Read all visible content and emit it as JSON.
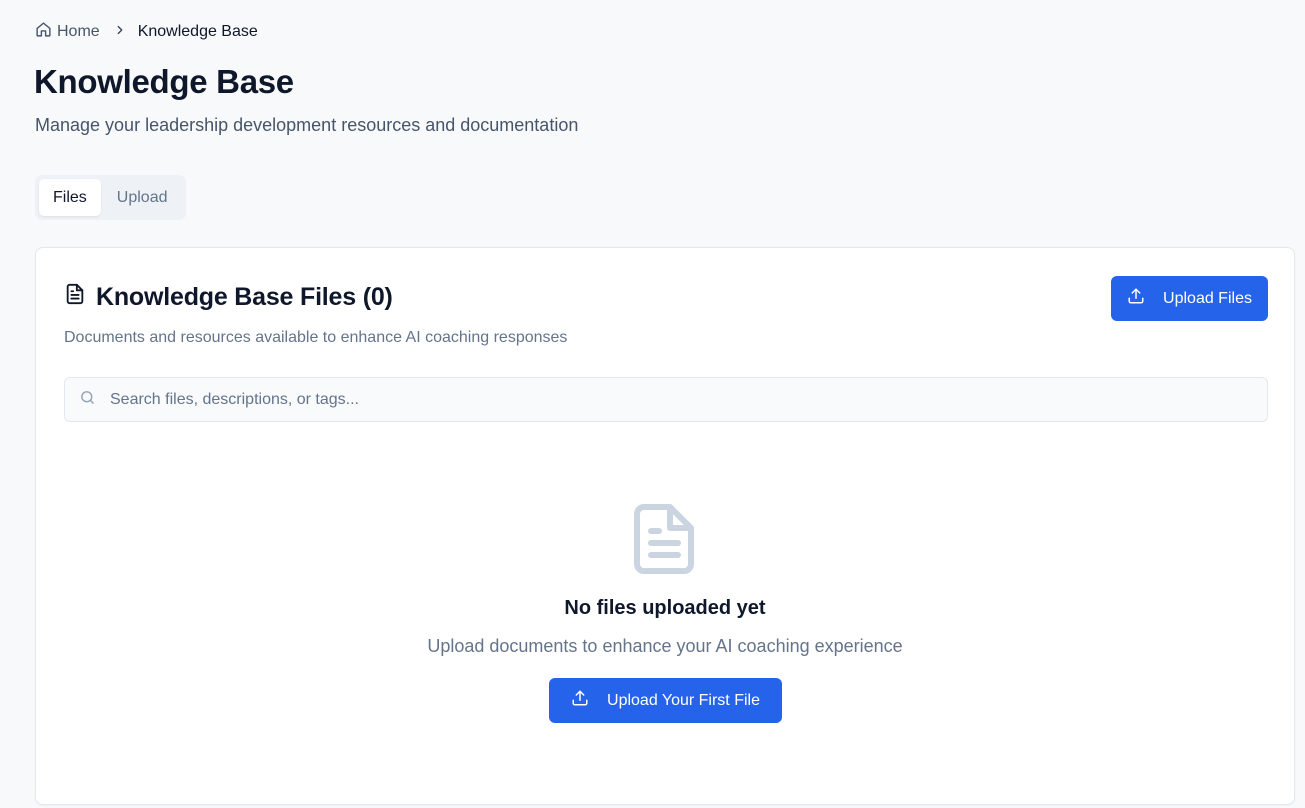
{
  "breadcrumb": {
    "home_label": "Home",
    "current_label": "Knowledge Base"
  },
  "header": {
    "title": "Knowledge Base",
    "subtitle": "Manage your leadership development resources and documentation"
  },
  "tabs": [
    {
      "label": "Files",
      "active": true
    },
    {
      "label": "Upload",
      "active": false
    }
  ],
  "files_card": {
    "title": "Knowledge Base Files (0)",
    "description": "Documents and resources available to enhance AI coaching responses",
    "upload_button_label": "Upload Files",
    "search": {
      "placeholder": "Search files, descriptions, or tags...",
      "value": ""
    },
    "empty_state": {
      "title": "No files uploaded yet",
      "description": "Upload documents to enhance your AI coaching experience",
      "button_label": "Upload Your First File"
    }
  },
  "icons": {
    "home": "home-icon",
    "separator": "chevron-right-icon",
    "card_title": "file-text-icon",
    "upload": "upload-icon",
    "search": "search-icon",
    "empty": "file-text-icon"
  },
  "colors": {
    "accent": "#2563eb",
    "background": "#f8f9fb",
    "text_primary": "#0f172a",
    "text_muted": "#64748b",
    "empty_icon": "#cbd5e1"
  }
}
